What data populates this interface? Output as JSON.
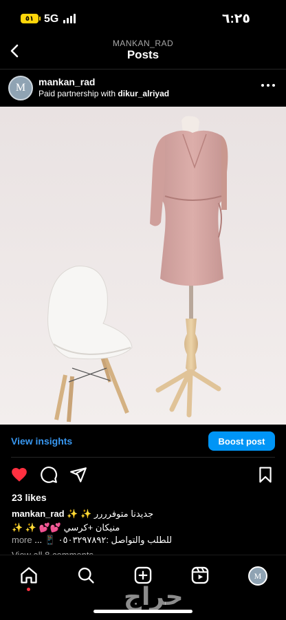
{
  "status_bar": {
    "battery": "٥١",
    "network": "5G",
    "time": "٦:٢٥"
  },
  "header": {
    "username": "MANKAN_RAD",
    "title": "Posts"
  },
  "post": {
    "author": "mankan_rad",
    "avatar_letter": "M",
    "partnership_prefix": "Paid partnership with",
    "partner": "dikur_alriyad"
  },
  "insights": {
    "view_label": "View insights",
    "boost_label": "Boost post"
  },
  "engagement": {
    "likes": "23 likes",
    "comments": "View all 8 comments"
  },
  "caption": {
    "user": "mankan_rad",
    "line1": "جديدنا متوفرررر ✨ ✨",
    "line2": "منيكان +كرسي 💕💕 ✨ ✨",
    "line3": "للطلب والتواصل :٠٥٠٣٢٩٧٨٩٢ 📱 ...",
    "more": "more"
  },
  "watermark": "حراج",
  "colors": {
    "accent": "#0095f6",
    "like": "#ff3040",
    "background": "#000000"
  }
}
